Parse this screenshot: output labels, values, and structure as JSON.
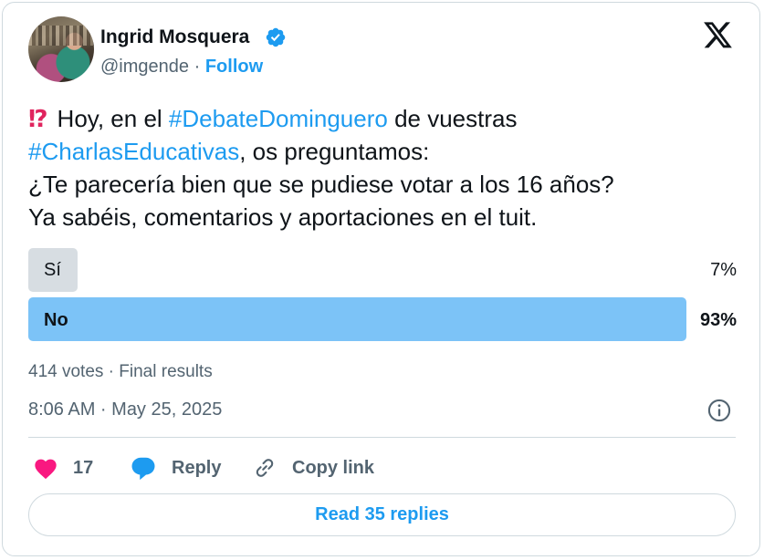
{
  "author": {
    "name": "Ingrid Mosquera",
    "handle": "@imgende",
    "separator": "·",
    "follow_label": "Follow",
    "verified_icon": "verified-badge-icon"
  },
  "tweet": {
    "emoji": "⁉",
    "text_parts": {
      "p1": "Hoy, en el ",
      "hashtag1": "#DebateDominguero",
      "p2": " de vuestras",
      "hashtag2": "#CharlasEducativas",
      "p3": ", os preguntamos:",
      "line3": "¿Te parecería bien que se pudiese votar a los 16 años?",
      "line4": "Ya sabéis, comentarios y aportaciones en el tuit."
    }
  },
  "poll": {
    "options": [
      {
        "label": "Sí",
        "percent_label": "7%",
        "percent": 7,
        "winner": false
      },
      {
        "label": "No",
        "percent_label": "93%",
        "percent": 93,
        "winner": true
      }
    ],
    "summary": "414 votes · Final results"
  },
  "meta": {
    "timestamp": "8:06 AM · May 25, 2025"
  },
  "actions": {
    "like_count": "17",
    "reply_label": "Reply",
    "copy_label": "Copy link"
  },
  "read_replies_label": "Read 35 replies",
  "colors": {
    "accent": "#1d9bf0",
    "winner_bar": "#7cc3f7",
    "loser_bar": "#d7dde2",
    "like": "#f91880"
  }
}
